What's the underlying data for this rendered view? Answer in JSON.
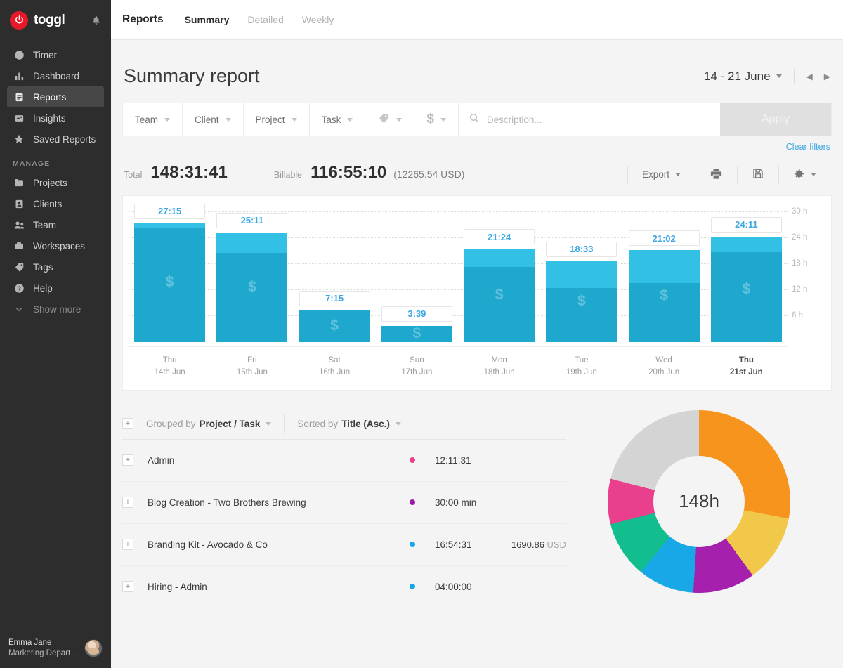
{
  "sidebar": {
    "brand": "toggl",
    "bell_icon": "bell-icon",
    "items": [
      {
        "label": "Timer",
        "icon": "clock-icon"
      },
      {
        "label": "Dashboard",
        "icon": "bar-chart-icon"
      },
      {
        "label": "Reports",
        "icon": "report-icon",
        "active": true
      },
      {
        "label": "Insights",
        "icon": "insights-icon"
      },
      {
        "label": "Saved Reports",
        "icon": "star-icon"
      }
    ],
    "section_label": "MANAGE",
    "manage_items": [
      {
        "label": "Projects",
        "icon": "folder-icon"
      },
      {
        "label": "Clients",
        "icon": "person-card-icon"
      },
      {
        "label": "Team",
        "icon": "people-icon"
      },
      {
        "label": "Workspaces",
        "icon": "briefcase-icon"
      },
      {
        "label": "Tags",
        "icon": "tag-icon"
      },
      {
        "label": "Help",
        "icon": "question-circle-icon"
      }
    ],
    "show_more": {
      "label": "Show more",
      "icon": "chevron-down-icon"
    },
    "user": {
      "name": "Emma Jane",
      "org": "Marketing Depart…"
    }
  },
  "topbar": {
    "title": "Reports",
    "tabs": [
      {
        "label": "Summary",
        "active": true
      },
      {
        "label": "Detailed",
        "active": false
      },
      {
        "label": "Weekly",
        "active": false
      }
    ]
  },
  "page": {
    "title": "Summary report",
    "date_range": "14 - 21 June",
    "prev_icon": "chevron-left-icon",
    "next_icon": "chevron-right-icon"
  },
  "filters": {
    "chips": [
      {
        "label": "Team",
        "icon": ""
      },
      {
        "label": "Client",
        "icon": ""
      },
      {
        "label": "Project",
        "icon": ""
      },
      {
        "label": "Task",
        "icon": ""
      },
      {
        "label": "",
        "icon": "tag-icon"
      },
      {
        "label": "",
        "icon": "dollar-icon"
      }
    ],
    "search_placeholder": "Description...",
    "search_value": "",
    "search_icon": "search-icon",
    "apply_label": "Apply",
    "clear_label": "Clear filters"
  },
  "totals": {
    "total_label": "Total",
    "total_value": "148:31:41",
    "billable_label": "Billable",
    "billable_value": "116:55:10",
    "billable_money": "(12265.54 USD)",
    "export_label": "Export",
    "print_icon": "printer-icon",
    "save_icon": "floppy-disk-icon",
    "settings_icon": "gear-icon"
  },
  "chart_data": {
    "type": "bar",
    "title": "",
    "xlabel": "",
    "ylabel": "",
    "ylim": [
      0,
      32
    ],
    "yticks": [
      "6 h",
      "12 h",
      "18 h",
      "24 h",
      "30 h"
    ],
    "ytick_values": [
      6,
      12,
      18,
      24,
      30
    ],
    "grid": true,
    "categories": [
      "Thu\n14th Jun",
      "Fri\n15th Jun",
      "Sat\n16th Jun",
      "Sun\n17th Jun",
      "Mon\n18th Jun",
      "Tue\n19th Jun",
      "Wed\n20th Jun",
      "Thu\n21st Jun"
    ],
    "days": [
      {
        "dow": "Thu",
        "date": "14th Jun",
        "label": "27:15",
        "total_hours": 27.25,
        "billable_hours": 26.3,
        "bold": false
      },
      {
        "dow": "Fri",
        "date": "15th Jun",
        "label": "25:11",
        "total_hours": 25.18,
        "billable_hours": 20.5,
        "bold": false
      },
      {
        "dow": "Sat",
        "date": "16th Jun",
        "label": "7:15",
        "total_hours": 7.25,
        "billable_hours": 7.25,
        "bold": false
      },
      {
        "dow": "Sun",
        "date": "17th Jun",
        "label": "3:39",
        "total_hours": 3.65,
        "billable_hours": 3.65,
        "bold": false
      },
      {
        "dow": "Mon",
        "date": "18th Jun",
        "label": "21:24",
        "total_hours": 21.4,
        "billable_hours": 17.2,
        "bold": false
      },
      {
        "dow": "Tue",
        "date": "19th Jun",
        "label": "18:33",
        "total_hours": 18.55,
        "billable_hours": 12.4,
        "bold": false
      },
      {
        "dow": "Wed",
        "date": "20th Jun",
        "label": "21:02",
        "total_hours": 21.03,
        "billable_hours": 13.5,
        "bold": false
      },
      {
        "dow": "Thu",
        "date": "21st Jun",
        "label": "24:11",
        "total_hours": 24.18,
        "billable_hours": 20.6,
        "bold": true
      }
    ],
    "series": [
      {
        "name": "Billable",
        "color": "#1fa8ce",
        "values": [
          26.3,
          20.5,
          7.25,
          3.65,
          17.2,
          12.4,
          13.5,
          20.6
        ]
      },
      {
        "name": "Non-billable",
        "color": "#33c0e5",
        "values": [
          0.95,
          4.68,
          0,
          0,
          4.2,
          6.15,
          7.53,
          3.58
        ]
      }
    ],
    "bar_fill": "#1fa8ce",
    "bar_top_fill": "#33c0e5",
    "label_color": "#3ba7e3",
    "watermark": "$"
  },
  "grouping": {
    "grouped_prefix": "Grouped by",
    "grouped_value": "Project / Task",
    "sorted_prefix": "Sorted by",
    "sorted_value": "Title (Asc.)",
    "expand_icon": "plus-box-icon"
  },
  "list": {
    "rows": [
      {
        "title": "Admin",
        "color": "#ea3f8c",
        "duration": "12:11:31",
        "amount": "",
        "currency": ""
      },
      {
        "title": "Blog Creation - Two Brothers Brewing",
        "color": "#9b1ba6",
        "duration": "30:00 min",
        "amount": "",
        "currency": ""
      },
      {
        "title": "Branding Kit - Avocado & Co",
        "color": "#18a8e8",
        "duration": "16:54:31",
        "amount": "1690.86",
        "currency": "USD"
      },
      {
        "title": "Hiring - Admin",
        "color": "#18a8e8",
        "duration": "04:00:00",
        "amount": "",
        "currency": ""
      }
    ]
  },
  "donut_chart": {
    "type": "pie",
    "center_label": "148h",
    "title": "",
    "slices": [
      {
        "name": "segment-1",
        "color": "#f7941e",
        "percent": 28
      },
      {
        "name": "segment-2",
        "color": "#f2c84b",
        "percent": 12
      },
      {
        "name": "segment-3",
        "color": "#a520ad",
        "percent": 11
      },
      {
        "name": "segment-4",
        "color": "#18a8e8",
        "percent": 10
      },
      {
        "name": "segment-5",
        "color": "#12bd8e",
        "percent": 10
      },
      {
        "name": "segment-6",
        "color": "#ea3f8c",
        "percent": 8
      },
      {
        "name": "segment-7",
        "color": "#d4d4d4",
        "percent": 21
      }
    ]
  }
}
